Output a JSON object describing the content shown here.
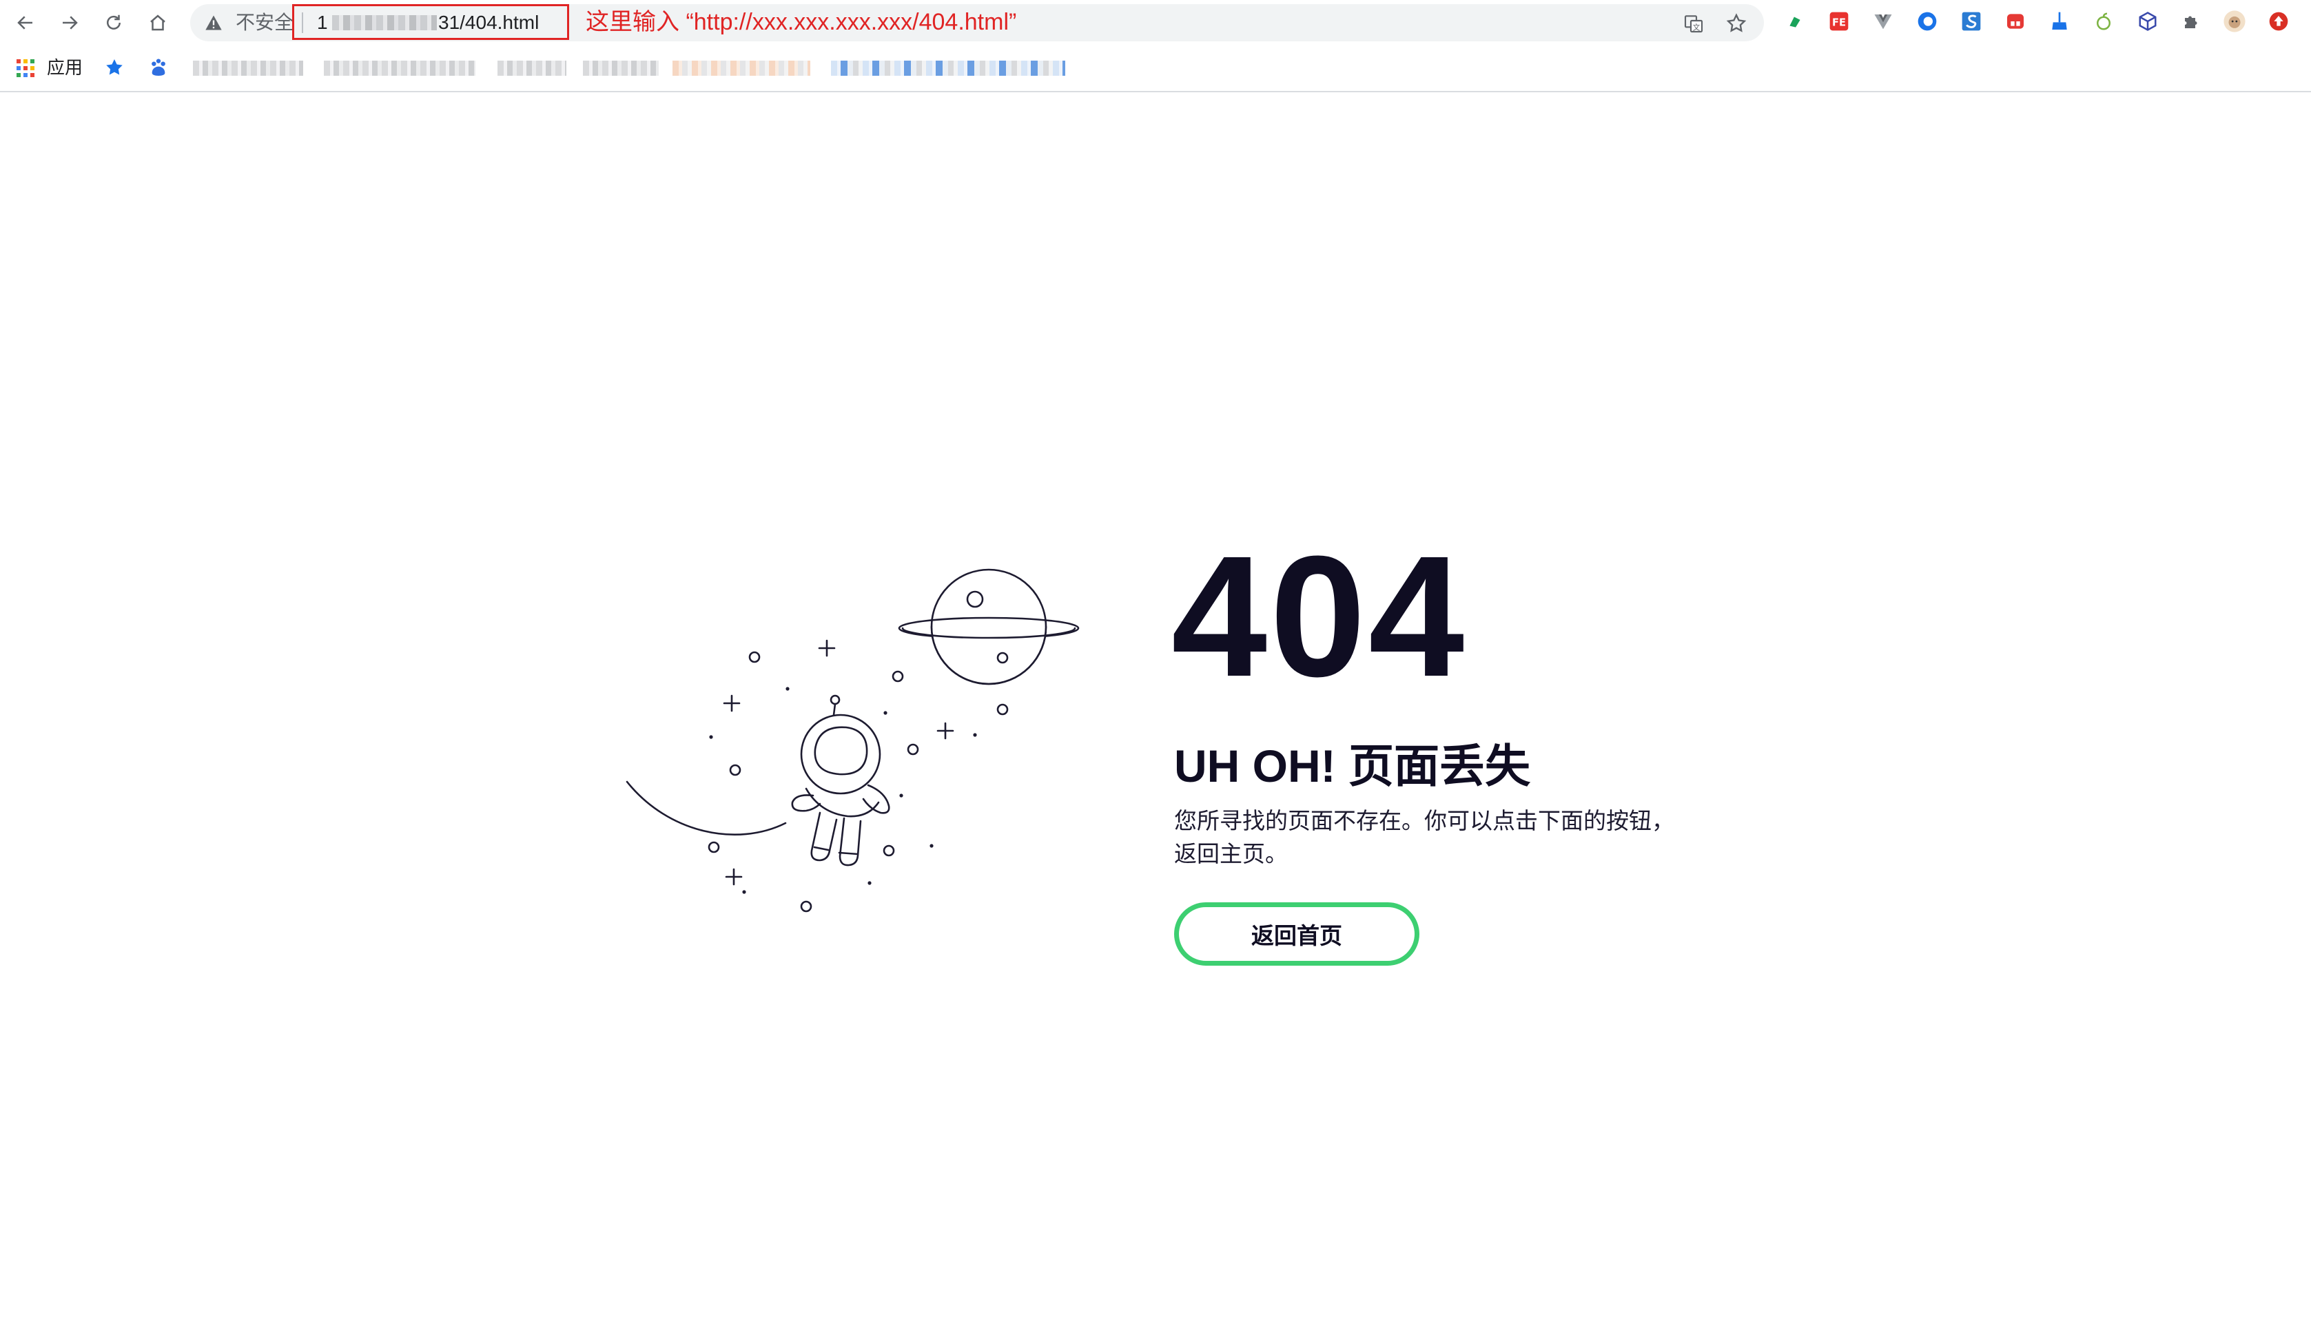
{
  "browser": {
    "security_label": "不安全",
    "url_prefix": "1",
    "url_suffix": "31/404.html",
    "annotation": "这里输入 “http://xxx.xxx.xxx.xxx/404.html”",
    "annotation_color": "#e02424",
    "toolbar_icons": [
      "back-icon",
      "forward-icon",
      "reload-icon",
      "home-icon",
      "translate-icon",
      "star-icon"
    ],
    "extension_icons": [
      "flag-ext-icon",
      "fe-ext-icon",
      "vue-ext-icon",
      "circle-ext-icon",
      "s-ext-icon",
      "red-ext-icon",
      "broom-ext-icon",
      "apple-ext-icon",
      "cube-ext-icon",
      "puzzle-icon",
      "profile-avatar",
      "update-icon"
    ]
  },
  "bookmarks": {
    "apps_label": "应用",
    "icons": [
      "star-bookmark-icon",
      "baidu-bookmark-icon"
    ]
  },
  "error_page": {
    "code": "404",
    "headline": "UH OH! 页面丢失",
    "description": "您所寻找的页面不存在。你可以点击下面的按钮，返回主页。",
    "button_label": "返回首页",
    "accent_color": "#3dcf71",
    "text_color": "#0f0d22"
  }
}
